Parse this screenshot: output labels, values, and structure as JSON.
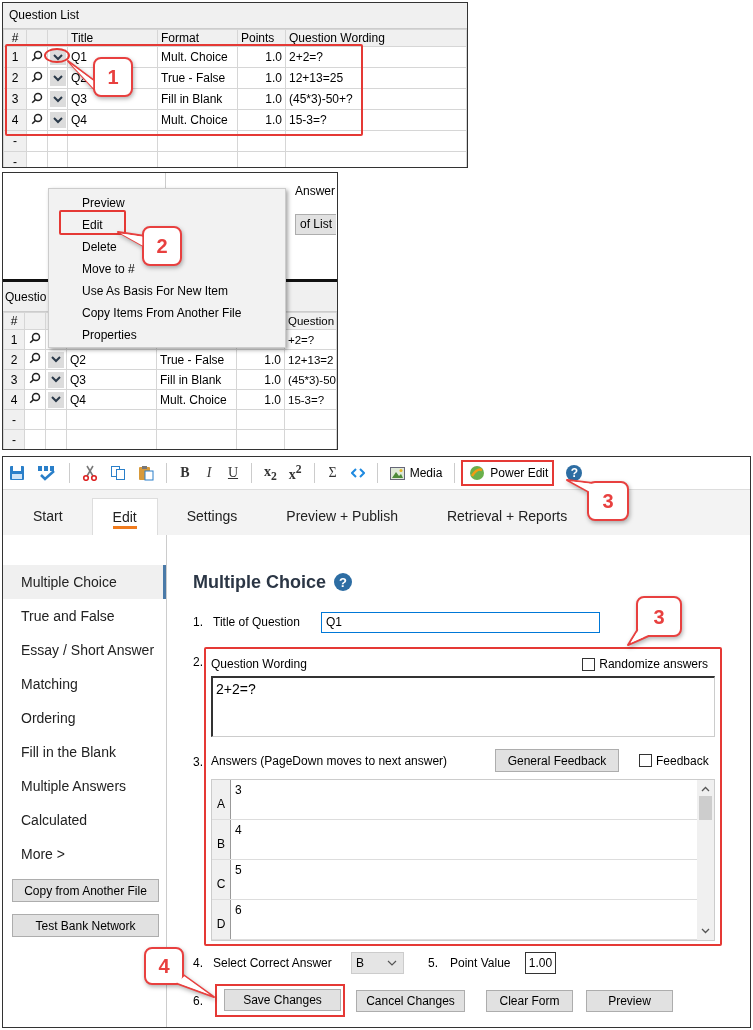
{
  "question_list": {
    "title": "Question List",
    "header": {
      "number": "#",
      "title": "Title",
      "format": "Format",
      "points": "Points",
      "wording": "Question Wording"
    },
    "rows": [
      {
        "number": "1",
        "title": "Q1",
        "format": "Mult. Choice",
        "points": "1.0",
        "wording": "2+2=?"
      },
      {
        "number": "2",
        "title": "Q2",
        "format": "True - False",
        "points": "1.0",
        "wording": "12+13=25"
      },
      {
        "number": "3",
        "title": "Q3",
        "format": "Fill in Blank",
        "points": "1.0",
        "wording": "(45*3)-50+?"
      },
      {
        "number": "4",
        "title": "Q4",
        "format": "Mult. Choice",
        "points": "1.0",
        "wording": "15-3=?"
      }
    ],
    "blank_rows": [
      "-",
      "-"
    ]
  },
  "background_view": {
    "answer_label": "Answer",
    "button": "of List",
    "list_title": "Questio",
    "header": {
      "number": "#",
      "wording": "Question"
    },
    "rows": [
      {
        "number": "1",
        "wording": "+2=?"
      },
      {
        "number": "2",
        "title": "Q2",
        "format": "True - False",
        "points": "1.0",
        "wording": "12+13=2"
      },
      {
        "number": "3",
        "title": "Q3",
        "format": "Fill in Blank",
        "points": "1.0",
        "wording": "(45*3)-50"
      },
      {
        "number": "4",
        "title": "Q4",
        "format": "Mult. Choice",
        "points": "1.0",
        "wording": "15-3=?"
      }
    ],
    "blank_rows": [
      "-",
      "-"
    ]
  },
  "context_menu": {
    "items": [
      "Preview",
      "Edit",
      "Delete",
      "Move to #",
      "Use As Basis For New Item",
      "Copy Items From Another File",
      "Properties"
    ]
  },
  "toolbar": {
    "bold": "B",
    "italic": "I",
    "underline": "U",
    "subscript": "x$_{2}$",
    "superscript": "x$^{2}$",
    "sum": "Σ",
    "media": "Media",
    "power_edit": "Power Edit",
    "help": "?"
  },
  "tabs": [
    {
      "label": "Start",
      "selected": false
    },
    {
      "label": "Edit",
      "selected": true
    },
    {
      "label": "Settings",
      "selected": false
    },
    {
      "label": "Preview + Publish",
      "selected": false
    },
    {
      "label": "Retrieval + Reports",
      "selected": false
    }
  ],
  "sidebar": {
    "items": [
      {
        "label": "Multiple Choice",
        "selected": true
      },
      {
        "label": "True and False",
        "selected": false
      },
      {
        "label": "Essay / Short Answer",
        "selected": false
      },
      {
        "label": "Matching",
        "selected": false
      },
      {
        "label": "Ordering",
        "selected": false
      },
      {
        "label": "Fill in the Blank",
        "selected": false
      },
      {
        "label": "Multiple Answers",
        "selected": false
      },
      {
        "label": "Calculated",
        "selected": false
      },
      {
        "label": "More >",
        "selected": false
      }
    ],
    "buttons": [
      "Copy from Another File",
      "Test Bank Network"
    ]
  },
  "form": {
    "heading": "Multiple Choice",
    "help": "?",
    "title_row": {
      "number": "1.",
      "label": "Title of Question",
      "value": "Q1"
    },
    "wording": {
      "number": "2.",
      "label": "Question Wording",
      "randomize": {
        "label": "Randomize answers",
        "checked": false
      },
      "value": "2+2=?"
    },
    "answers": {
      "number": "3.",
      "label": "Answers  (PageDown moves to next answer)",
      "general_feedback": "General Feedback",
      "feedback": {
        "label": "Feedback",
        "checked": false
      },
      "rows": [
        {
          "letter": "A",
          "text": "3"
        },
        {
          "letter": "B",
          "text": "4"
        },
        {
          "letter": "C",
          "text": "5"
        },
        {
          "letter": "D",
          "text": "6"
        }
      ]
    },
    "correct": {
      "number": "4.",
      "label": "Select Correct Answer",
      "value": "B"
    },
    "point": {
      "number": "5.",
      "label": "Point Value",
      "value": "1.00"
    },
    "actions": {
      "number": "6.",
      "buttons": [
        "Save Changes",
        "Cancel Changes",
        "Clear Form",
        "Preview"
      ]
    }
  },
  "callouts": [
    "1",
    "2",
    "3",
    "3",
    "4"
  ]
}
